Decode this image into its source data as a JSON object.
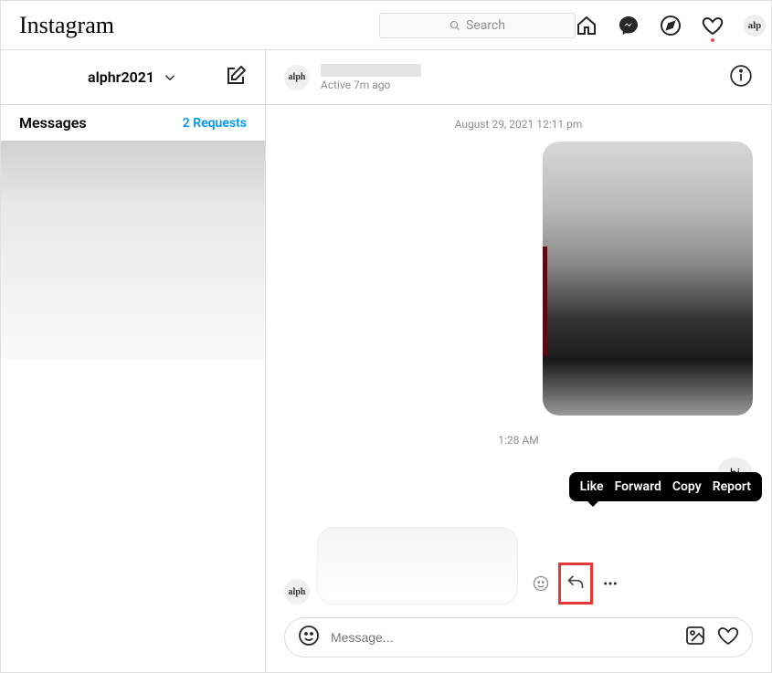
{
  "nav": {
    "logo": "Instagram",
    "search_placeholder": "Search",
    "avatar_text": "alp"
  },
  "sidebar": {
    "username": "alphr2021",
    "messages_label": "Messages",
    "requests_label": "2 Requests"
  },
  "chat": {
    "avatar_text": "alph",
    "status": "Active 7m ago",
    "date_sep": "August 29, 2021 12:11 pm",
    "time_sep": "1:28 AM",
    "bubble_out_text": "hi",
    "incoming_avatar_text": "alph"
  },
  "tooltip": {
    "like": "Like",
    "forward": "Forward",
    "copy": "Copy",
    "report": "Report"
  },
  "composer": {
    "placeholder": "Message..."
  }
}
